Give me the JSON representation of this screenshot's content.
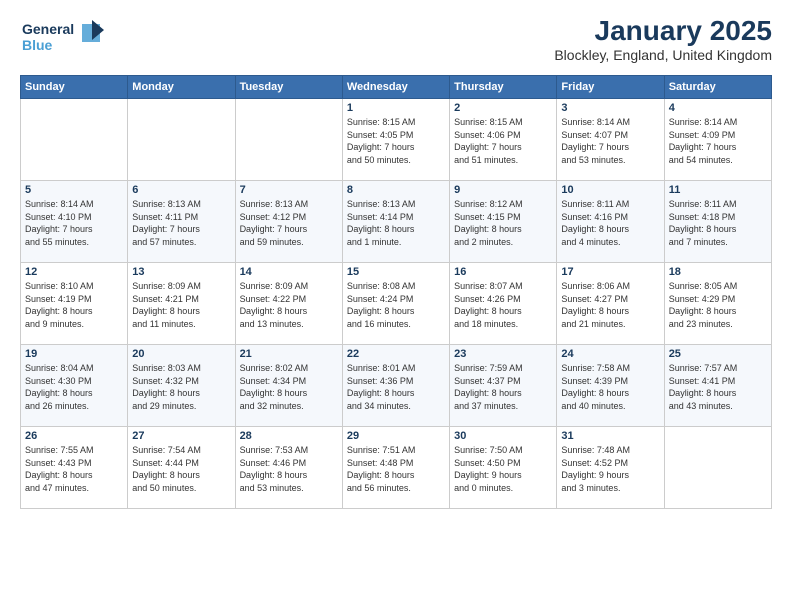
{
  "logo": {
    "line1": "General",
    "line2": "Blue"
  },
  "title": "January 2025",
  "subtitle": "Blockley, England, United Kingdom",
  "weekdays": [
    "Sunday",
    "Monday",
    "Tuesday",
    "Wednesday",
    "Thursday",
    "Friday",
    "Saturday"
  ],
  "weeks": [
    [
      {
        "day": "",
        "detail": ""
      },
      {
        "day": "",
        "detail": ""
      },
      {
        "day": "",
        "detail": ""
      },
      {
        "day": "1",
        "detail": "Sunrise: 8:15 AM\nSunset: 4:05 PM\nDaylight: 7 hours\nand 50 minutes."
      },
      {
        "day": "2",
        "detail": "Sunrise: 8:15 AM\nSunset: 4:06 PM\nDaylight: 7 hours\nand 51 minutes."
      },
      {
        "day": "3",
        "detail": "Sunrise: 8:14 AM\nSunset: 4:07 PM\nDaylight: 7 hours\nand 53 minutes."
      },
      {
        "day": "4",
        "detail": "Sunrise: 8:14 AM\nSunset: 4:09 PM\nDaylight: 7 hours\nand 54 minutes."
      }
    ],
    [
      {
        "day": "5",
        "detail": "Sunrise: 8:14 AM\nSunset: 4:10 PM\nDaylight: 7 hours\nand 55 minutes."
      },
      {
        "day": "6",
        "detail": "Sunrise: 8:13 AM\nSunset: 4:11 PM\nDaylight: 7 hours\nand 57 minutes."
      },
      {
        "day": "7",
        "detail": "Sunrise: 8:13 AM\nSunset: 4:12 PM\nDaylight: 7 hours\nand 59 minutes."
      },
      {
        "day": "8",
        "detail": "Sunrise: 8:13 AM\nSunset: 4:14 PM\nDaylight: 8 hours\nand 1 minute."
      },
      {
        "day": "9",
        "detail": "Sunrise: 8:12 AM\nSunset: 4:15 PM\nDaylight: 8 hours\nand 2 minutes."
      },
      {
        "day": "10",
        "detail": "Sunrise: 8:11 AM\nSunset: 4:16 PM\nDaylight: 8 hours\nand 4 minutes."
      },
      {
        "day": "11",
        "detail": "Sunrise: 8:11 AM\nSunset: 4:18 PM\nDaylight: 8 hours\nand 7 minutes."
      }
    ],
    [
      {
        "day": "12",
        "detail": "Sunrise: 8:10 AM\nSunset: 4:19 PM\nDaylight: 8 hours\nand 9 minutes."
      },
      {
        "day": "13",
        "detail": "Sunrise: 8:09 AM\nSunset: 4:21 PM\nDaylight: 8 hours\nand 11 minutes."
      },
      {
        "day": "14",
        "detail": "Sunrise: 8:09 AM\nSunset: 4:22 PM\nDaylight: 8 hours\nand 13 minutes."
      },
      {
        "day": "15",
        "detail": "Sunrise: 8:08 AM\nSunset: 4:24 PM\nDaylight: 8 hours\nand 16 minutes."
      },
      {
        "day": "16",
        "detail": "Sunrise: 8:07 AM\nSunset: 4:26 PM\nDaylight: 8 hours\nand 18 minutes."
      },
      {
        "day": "17",
        "detail": "Sunrise: 8:06 AM\nSunset: 4:27 PM\nDaylight: 8 hours\nand 21 minutes."
      },
      {
        "day": "18",
        "detail": "Sunrise: 8:05 AM\nSunset: 4:29 PM\nDaylight: 8 hours\nand 23 minutes."
      }
    ],
    [
      {
        "day": "19",
        "detail": "Sunrise: 8:04 AM\nSunset: 4:30 PM\nDaylight: 8 hours\nand 26 minutes."
      },
      {
        "day": "20",
        "detail": "Sunrise: 8:03 AM\nSunset: 4:32 PM\nDaylight: 8 hours\nand 29 minutes."
      },
      {
        "day": "21",
        "detail": "Sunrise: 8:02 AM\nSunset: 4:34 PM\nDaylight: 8 hours\nand 32 minutes."
      },
      {
        "day": "22",
        "detail": "Sunrise: 8:01 AM\nSunset: 4:36 PM\nDaylight: 8 hours\nand 34 minutes."
      },
      {
        "day": "23",
        "detail": "Sunrise: 7:59 AM\nSunset: 4:37 PM\nDaylight: 8 hours\nand 37 minutes."
      },
      {
        "day": "24",
        "detail": "Sunrise: 7:58 AM\nSunset: 4:39 PM\nDaylight: 8 hours\nand 40 minutes."
      },
      {
        "day": "25",
        "detail": "Sunrise: 7:57 AM\nSunset: 4:41 PM\nDaylight: 8 hours\nand 43 minutes."
      }
    ],
    [
      {
        "day": "26",
        "detail": "Sunrise: 7:55 AM\nSunset: 4:43 PM\nDaylight: 8 hours\nand 47 minutes."
      },
      {
        "day": "27",
        "detail": "Sunrise: 7:54 AM\nSunset: 4:44 PM\nDaylight: 8 hours\nand 50 minutes."
      },
      {
        "day": "28",
        "detail": "Sunrise: 7:53 AM\nSunset: 4:46 PM\nDaylight: 8 hours\nand 53 minutes."
      },
      {
        "day": "29",
        "detail": "Sunrise: 7:51 AM\nSunset: 4:48 PM\nDaylight: 8 hours\nand 56 minutes."
      },
      {
        "day": "30",
        "detail": "Sunrise: 7:50 AM\nSunset: 4:50 PM\nDaylight: 9 hours\nand 0 minutes."
      },
      {
        "day": "31",
        "detail": "Sunrise: 7:48 AM\nSunset: 4:52 PM\nDaylight: 9 hours\nand 3 minutes."
      },
      {
        "day": "",
        "detail": ""
      }
    ]
  ]
}
